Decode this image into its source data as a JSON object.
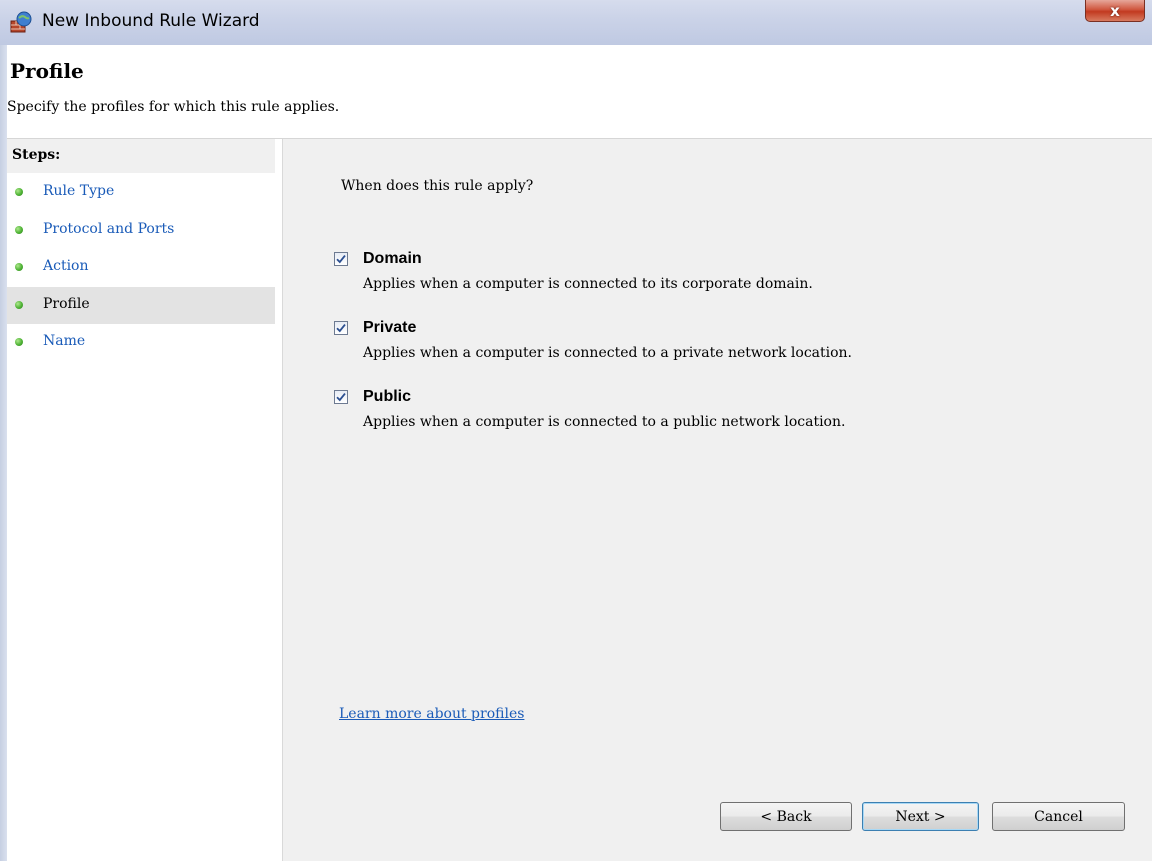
{
  "window": {
    "title": "New Inbound Rule Wizard",
    "close_label": "x"
  },
  "header": {
    "title": "Profile",
    "description": "Specify the profiles for which this rule applies."
  },
  "steps": {
    "heading": "Steps:",
    "items": [
      {
        "label": "Rule Type",
        "current": false
      },
      {
        "label": "Protocol and Ports",
        "current": false
      },
      {
        "label": "Action",
        "current": false
      },
      {
        "label": "Profile",
        "current": true
      },
      {
        "label": "Name",
        "current": false
      }
    ]
  },
  "main": {
    "question": "When does this rule apply?",
    "options": [
      {
        "label": "Domain",
        "description": "Applies when a computer is connected to its corporate domain.",
        "checked": true
      },
      {
        "label": "Private",
        "description": "Applies when a computer is connected to a private network location.",
        "checked": true
      },
      {
        "label": "Public",
        "description": "Applies when a computer is connected to a public network location.",
        "checked": true
      }
    ],
    "learn_more": "Learn more about profiles"
  },
  "buttons": {
    "back": "< Back",
    "next": "Next >",
    "cancel": "Cancel"
  },
  "colors": {
    "link": "#1a5bb8",
    "step_dot": "#4fb335"
  }
}
